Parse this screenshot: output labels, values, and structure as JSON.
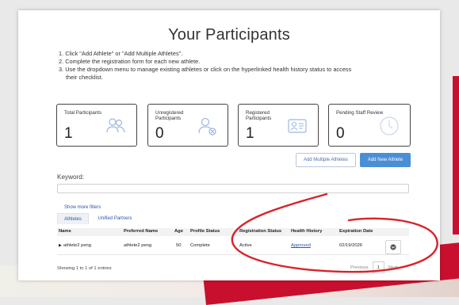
{
  "page": {
    "title": "Your Participants",
    "instructions": [
      "1. Click \"Add Athlete\" or \"Add Multiple Athletes\".",
      "2. Complete the registration form for each new athlete.",
      "3. Use the dropdown menu to manage existing athletes or click on the hyperlinked health history status to access",
      "their checklist."
    ]
  },
  "cards": [
    {
      "label": "Total Participants",
      "value": "1",
      "icon": "people-icon"
    },
    {
      "label": "Unregistered Participants",
      "value": "0",
      "icon": "user-remove-icon"
    },
    {
      "label": "Registered Participants",
      "value": "1",
      "icon": "id-card-icon"
    },
    {
      "label": "Pending Staff Review",
      "value": "0",
      "icon": "clock-icon"
    }
  ],
  "buttons": {
    "add_multiple": "Add Multiple Athletes",
    "add_new": "Add New Athlete"
  },
  "search": {
    "label": "Keyword:",
    "value": ""
  },
  "filters": {
    "show_more": "Show more filters"
  },
  "tabs": [
    "Athletes",
    "Unified Partners"
  ],
  "table": {
    "headers": [
      "Name",
      "Preferred Name",
      "Age",
      "Profile Status",
      "Registration Status",
      "Health History",
      "Expiration Date"
    ],
    "rows": [
      {
        "name": "athlete2 peng",
        "preferred": "athlete2 peng",
        "age": "50",
        "profile": "Complete",
        "registration": "Active",
        "health": "Approved",
        "expiration": "02/19/2026"
      }
    ],
    "info": "Showing 1 to 1 of 1 entries"
  },
  "pagination": {
    "previous": "Previous",
    "current": "1",
    "next": "Next"
  },
  "colors": {
    "accent": "#4a8fd6",
    "link": "#2a56a8",
    "annotation": "#d8232a"
  }
}
